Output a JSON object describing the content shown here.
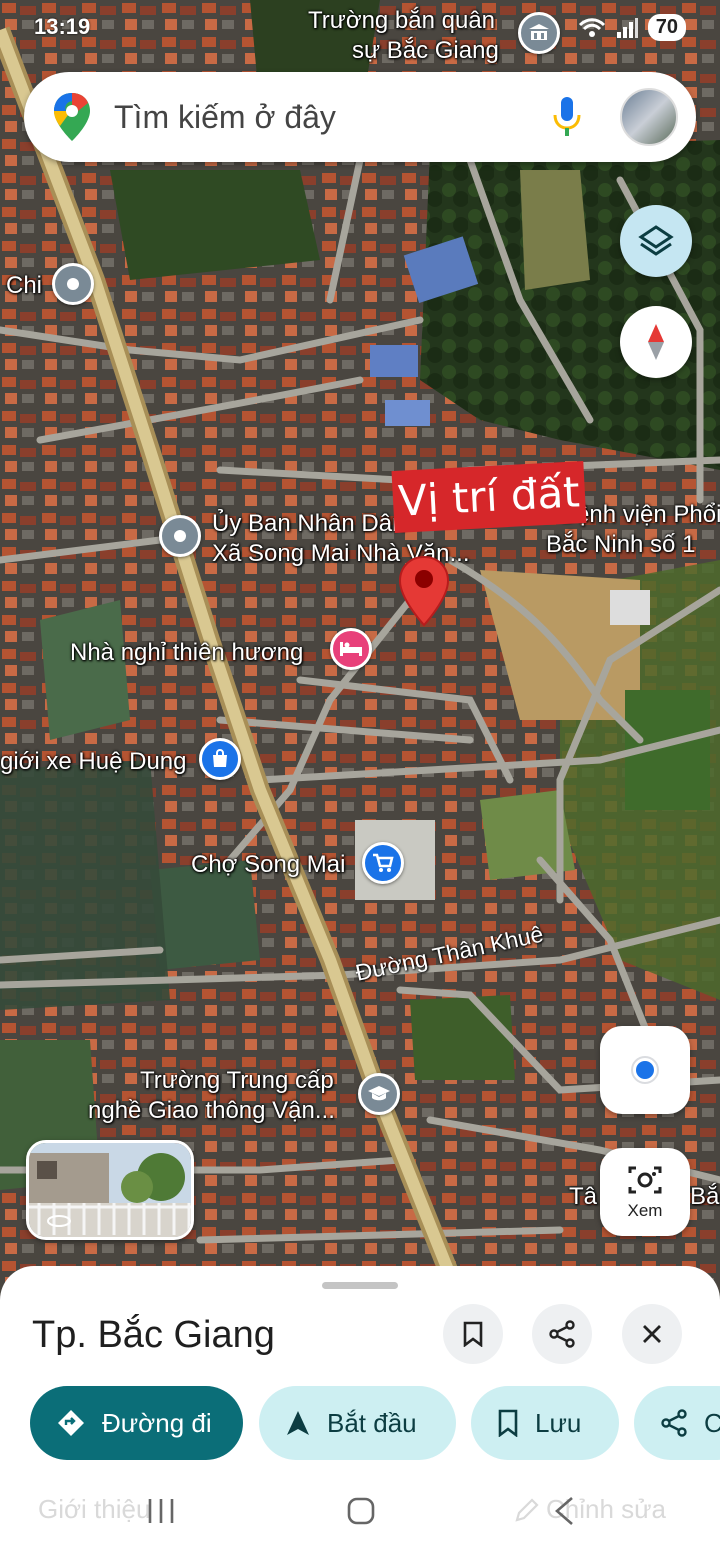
{
  "status_bar": {
    "time": "13:19",
    "battery": "70"
  },
  "search": {
    "placeholder": "Tìm kiếm ở đây"
  },
  "map": {
    "land_label": "Vị trí đất",
    "pois": [
      {
        "label": "Trường bắn quân\nsự Bắc Giang",
        "line1": "Trường bắn quân",
        "line2": "sự Bắc Giang"
      },
      {
        "label": "Chi"
      },
      {
        "line1": "Ủy Ban Nhân Dân",
        "line2": "Xã Song Mai Nhà Văn..."
      },
      {
        "line1": "Bệnh viện Phổi",
        "line2": "Bắc Ninh số 1"
      },
      {
        "label": "Nhà nghỉ thiên hương"
      },
      {
        "label": "giới xe Huệ Dung"
      },
      {
        "label": "Chợ Song Mai"
      },
      {
        "line1": "Trường Trung cấp",
        "line2": "nghề Giao thông Vận..."
      },
      {
        "label": "Tâ",
        "label2": "Bắc"
      }
    ],
    "road_label": "Đường Thân Khuê"
  },
  "controls": {
    "lens_label": "Xem"
  },
  "sheet": {
    "title": "Tp. Bắc Giang",
    "chips": {
      "directions": "Đường đi",
      "start": "Bắt đầu",
      "save": "Lưu",
      "share": "C"
    },
    "tabs": {
      "intro": "Giới thiệu",
      "edit": "Chỉnh sửa"
    }
  },
  "colors": {
    "primary_chip": "#0b6e78",
    "secondary_chip": "#cdeff2",
    "land_label_bg": "#d6272a",
    "marker": "#e53935"
  }
}
